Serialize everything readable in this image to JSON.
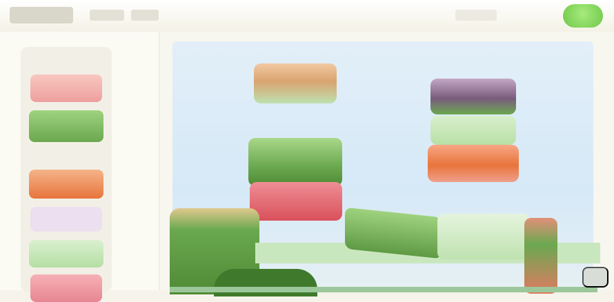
{
  "colors": {
    "bg": "#f6f4ea",
    "sky": "#d6e9f7",
    "grass": "#6aa84f",
    "grass_dark": "#4f8a34",
    "grass_light": "#9bd07f",
    "red": "#d9505a",
    "orange": "#e8743b",
    "purple": "#7a5b7d",
    "sand": "#d9a470",
    "pale_green": "#cfe9c3",
    "play": "#7fd356"
  },
  "tray_pieces": [
    {
      "name": "tray-piece-salmon",
      "color": "#eea0a0"
    },
    {
      "name": "tray-piece-green",
      "color": "#76b85a"
    },
    {
      "name": "tray-piece-orange",
      "color": "#ea8a58"
    },
    {
      "name": "tray-piece-lavender",
      "color": "#e8d8ee"
    },
    {
      "name": "tray-piece-light-green",
      "color": "#c9e8bd"
    },
    {
      "name": "tray-piece-pink",
      "color": "#ef9aa4"
    }
  ]
}
